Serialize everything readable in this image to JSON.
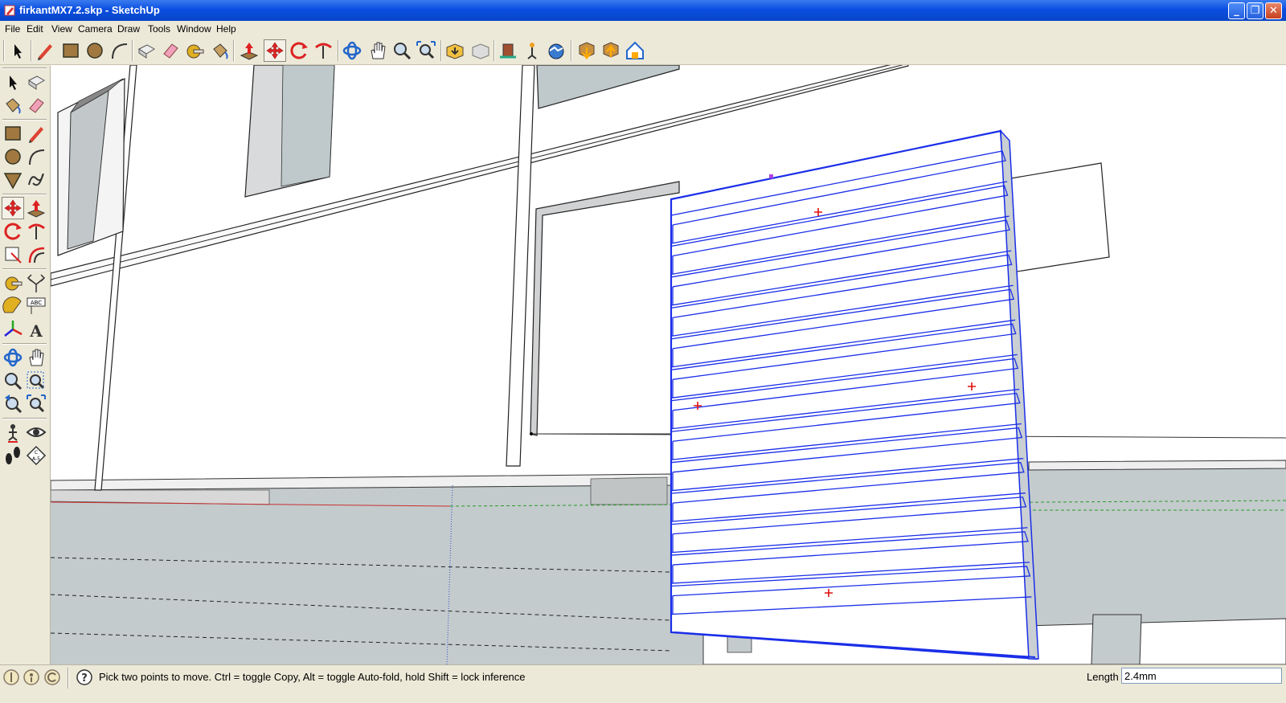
{
  "window": {
    "title": "firkantMX7.2.skp - SketchUp",
    "controls": [
      "minimize",
      "maximize",
      "close"
    ]
  },
  "menu": [
    "File",
    "Edit",
    "View",
    "Camera",
    "Draw",
    "Tools",
    "Window",
    "Help"
  ],
  "toolbar": {
    "tools": [
      "select-icon",
      "pencil-icon",
      "rectangle-icon",
      "circle-icon",
      "arc-icon",
      "make-component-icon",
      "eraser-icon",
      "tape-measure-icon",
      "paint-bucket-icon",
      "push-pull-icon",
      "move-icon",
      "rotate-icon",
      "follow-me-icon",
      "orbit-icon",
      "pan-icon",
      "zoom-icon",
      "zoom-extents-icon",
      "get-models-icon",
      "share-model-icon",
      "place-model-icon",
      "get-current-view-icon",
      "toggle-terrain-icon",
      "previous-view-icon",
      "next-view-icon",
      "3d-warehouse-icon"
    ],
    "active_tool": "move-icon"
  },
  "palette": {
    "tools": [
      "select-icon",
      "make-component-icon",
      "paint-bucket-icon",
      "eraser-icon",
      "rectangle-icon",
      "line-icon",
      "circle-icon",
      "arc-icon",
      "polygon-icon",
      "freehand-icon",
      "move-icon",
      "push-pull-icon",
      "rotate-icon",
      "follow-me-icon",
      "scale-icon",
      "offset-icon",
      "tape-measure-icon",
      "dimension-icon",
      "protractor-icon",
      "text-icon",
      "axes-icon",
      "3d-text-icon",
      "orbit-icon",
      "pan-icon",
      "zoom-icon",
      "zoom-window-icon",
      "previous-icon",
      "zoom-extents-icon",
      "position-camera-icon",
      "look-around-icon",
      "walk-icon",
      "section-plane-icon"
    ],
    "active_tool": "move-icon"
  },
  "status": {
    "hint": "Pick two points to move.  Ctrl = toggle Copy, Alt = toggle Auto-fold, hold Shift = lock inference",
    "vcb_label": "Length",
    "vcb_value": "2.4mm"
  }
}
